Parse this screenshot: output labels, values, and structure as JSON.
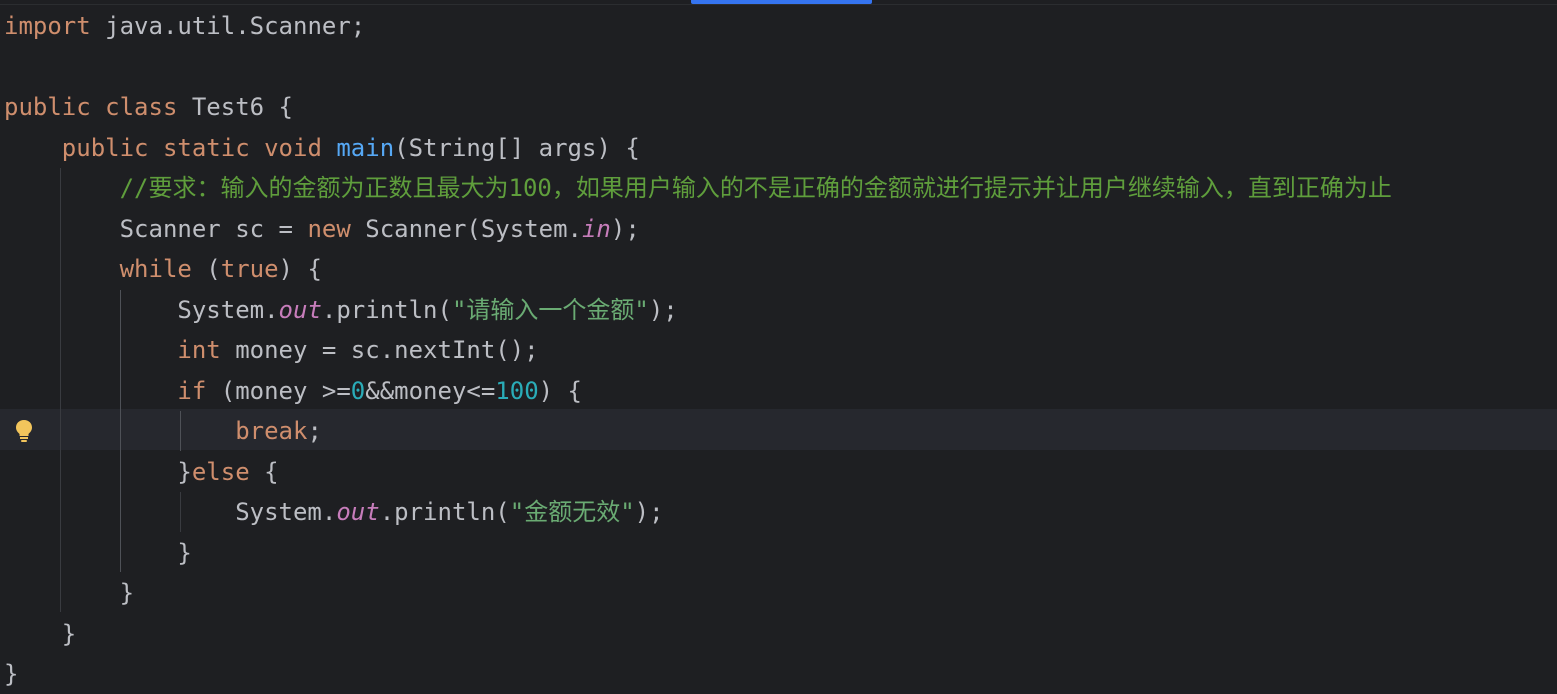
{
  "editor": {
    "lines": {
      "l1": {
        "kw": "import",
        "rest": " java.util.Scanner;"
      },
      "l3": {
        "kw1": "public",
        "kw2": "class",
        "rest": " Test6 {"
      },
      "l4": {
        "kw1": "public",
        "kw2": "static",
        "kw3": "void",
        "fn": "main",
        "rest": "(String[] args) {"
      },
      "l5": {
        "comment": "//要求：输入的金额为正数且最大为100，如果用户输入的不是正确的金额就进行提示并让用户继续输入，直到正确为止"
      },
      "l6": {
        "a": "Scanner sc = ",
        "kw": "new",
        "b": " Scanner(System.",
        "st": "in",
        "c": ");"
      },
      "l7": {
        "kw": "while",
        "a": " (",
        "kw2": "true",
        "b": ") {"
      },
      "l8": {
        "a": "System.",
        "st": "out",
        "b": ".println(",
        "str": "\"请输入一个金额\"",
        "c": ");"
      },
      "l9": {
        "kw": "int",
        "rest": " money = sc.nextInt();"
      },
      "l10": {
        "kw": "if",
        "a": " (money >=",
        "num1": "0",
        "b": "&&money<=",
        "num2": "100",
        "c": ") {"
      },
      "l11": {
        "kw": "break",
        "rest": ";"
      },
      "l12": {
        "a": "}",
        "kw": "else",
        "b": " {"
      },
      "l13": {
        "a": "System.",
        "st": "out",
        "b": ".println(",
        "str": "\"金额无效\"",
        "c": ");"
      },
      "l14": {
        "text": "}"
      },
      "l15": {
        "text": "}"
      },
      "l16": {
        "text": "}"
      },
      "l17": {
        "text": "}"
      }
    },
    "gutter": {
      "icon": "lightbulb-icon",
      "icon_color": "#f2c55c"
    }
  }
}
